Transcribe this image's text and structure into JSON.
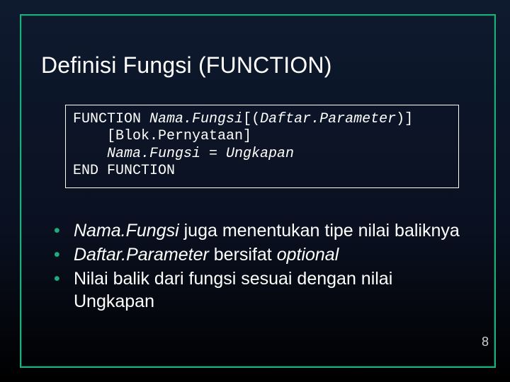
{
  "title": "Definisi Fungsi (FUNCTION)",
  "code": {
    "kw_function": "FUNCTION ",
    "nama_fungsi": "Nama.Fungsi",
    "params_open": "[(",
    "daftar_parameter": "Daftar.Parameter",
    "params_close": ")]",
    "line2": "    [Blok.Pernyataan]",
    "line3_prefix": "    ",
    "line3_nama": "Nama.Fungsi = Ungkapan",
    "end": "END FUNCTION"
  },
  "bullets": {
    "b1_em": "Nama.Fungsi",
    "b1_rest": " juga menentukan tipe nilai baliknya",
    "b2_em1": "Daftar.Parameter",
    "b2_mid": " bersifat ",
    "b2_em2": "optional",
    "b3": "Nilai balik dari fungsi sesuai dengan nilai Ungkapan"
  },
  "page_number": "8"
}
